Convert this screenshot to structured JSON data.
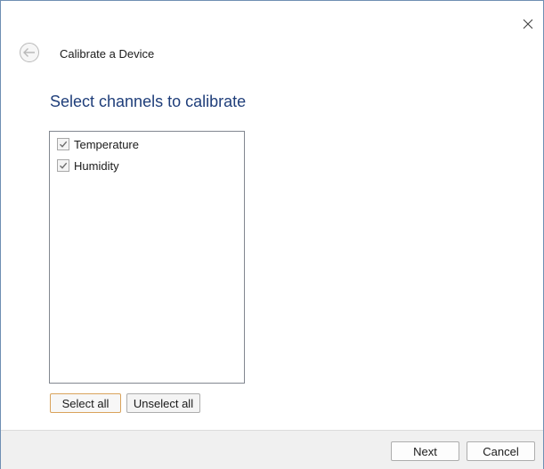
{
  "window": {
    "title": "Calibrate a Device"
  },
  "heading": "Select channels to calibrate",
  "channels": [
    {
      "label": "Temperature",
      "checked": true
    },
    {
      "label": "Humidity",
      "checked": true
    }
  ],
  "list_buttons": {
    "select_all": "Select all",
    "unselect_all": "Unselect all"
  },
  "footer": {
    "next": "Next",
    "cancel": "Cancel"
  },
  "icons": {
    "close": "close-icon",
    "back": "back-arrow-icon",
    "checkmark": "checkmark-icon"
  },
  "colors": {
    "heading": "#1f3e7a",
    "window_border": "#6f8fb3",
    "default_button_border": "#d9a35b",
    "footer_background": "#f0f0f0"
  }
}
